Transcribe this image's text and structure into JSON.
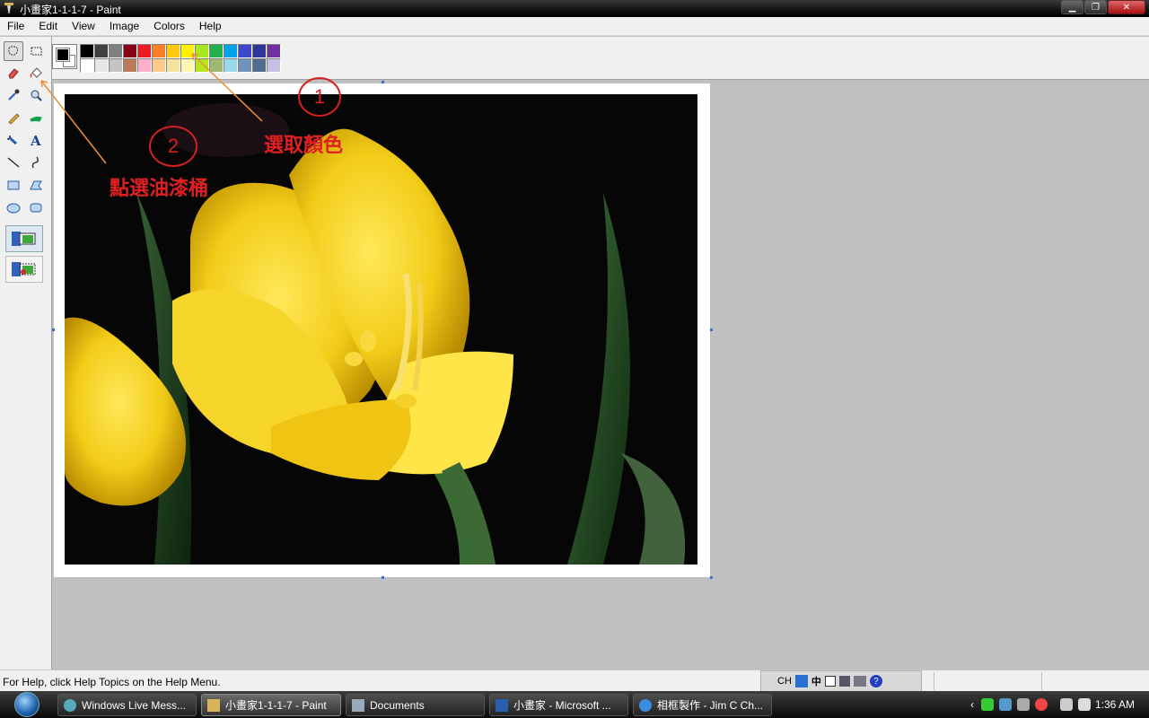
{
  "window": {
    "title": "小畫家1-1-1-7 - Paint"
  },
  "menu": [
    "File",
    "Edit",
    "View",
    "Image",
    "Colors",
    "Help"
  ],
  "palette": {
    "foreground": "#000000",
    "background": "#ffffff",
    "row1": [
      "#000000",
      "#404040",
      "#808080",
      "#880015",
      "#ed1c24",
      "#ff7f27",
      "#ffc90e",
      "#fff200",
      "#a8e61d",
      "#22b14c",
      "#00a2e8",
      "#3f48cc",
      "#2f3699",
      "#7030a0"
    ],
    "row2": [
      "#ffffff",
      "#e6e6e6",
      "#c3c3c3",
      "#b97a57",
      "#ffaec9",
      "#ffc98a",
      "#f5e1a0",
      "#fff5b4",
      "#b5e61d",
      "#9fb873",
      "#99d9ea",
      "#7092be",
      "#546d8e",
      "#c8bfe7"
    ]
  },
  "tools": [
    {
      "name": "free-form-select-icon",
      "sel": true
    },
    {
      "name": "select-icon",
      "sel": false
    },
    {
      "name": "eraser-icon",
      "sel": false
    },
    {
      "name": "fill-bucket-icon",
      "sel": false
    },
    {
      "name": "color-picker-icon",
      "sel": false
    },
    {
      "name": "magnifier-icon",
      "sel": false
    },
    {
      "name": "pencil-icon",
      "sel": false
    },
    {
      "name": "brush-icon",
      "sel": false
    },
    {
      "name": "airbrush-icon",
      "sel": false
    },
    {
      "name": "text-icon",
      "sel": false
    },
    {
      "name": "line-icon",
      "sel": false
    },
    {
      "name": "curve-icon",
      "sel": false
    },
    {
      "name": "rectangle-icon",
      "sel": false
    },
    {
      "name": "polygon-icon",
      "sel": false
    },
    {
      "name": "ellipse-icon",
      "sel": false
    },
    {
      "name": "rounded-rectangle-icon",
      "sel": false
    }
  ],
  "annotations": {
    "step1_number": "1",
    "step1_text": "選取顏色",
    "step2_number": "2",
    "step2_text": "點選油漆桶"
  },
  "status": {
    "help_text": "For Help, click Help Topics on the Help Menu.",
    "lang": "CH",
    "ime": "中"
  },
  "taskbar": {
    "tasks": [
      {
        "label": "Windows Live Mess...",
        "active": false
      },
      {
        "label": "小畫家1-1-1-7 - Paint",
        "active": true
      },
      {
        "label": "Documents",
        "active": false
      },
      {
        "label": "小畫家 - Microsoft ...",
        "active": false
      },
      {
        "label": "相框製作 - Jim C Ch...",
        "active": false
      }
    ],
    "clock": "1:36 AM"
  }
}
